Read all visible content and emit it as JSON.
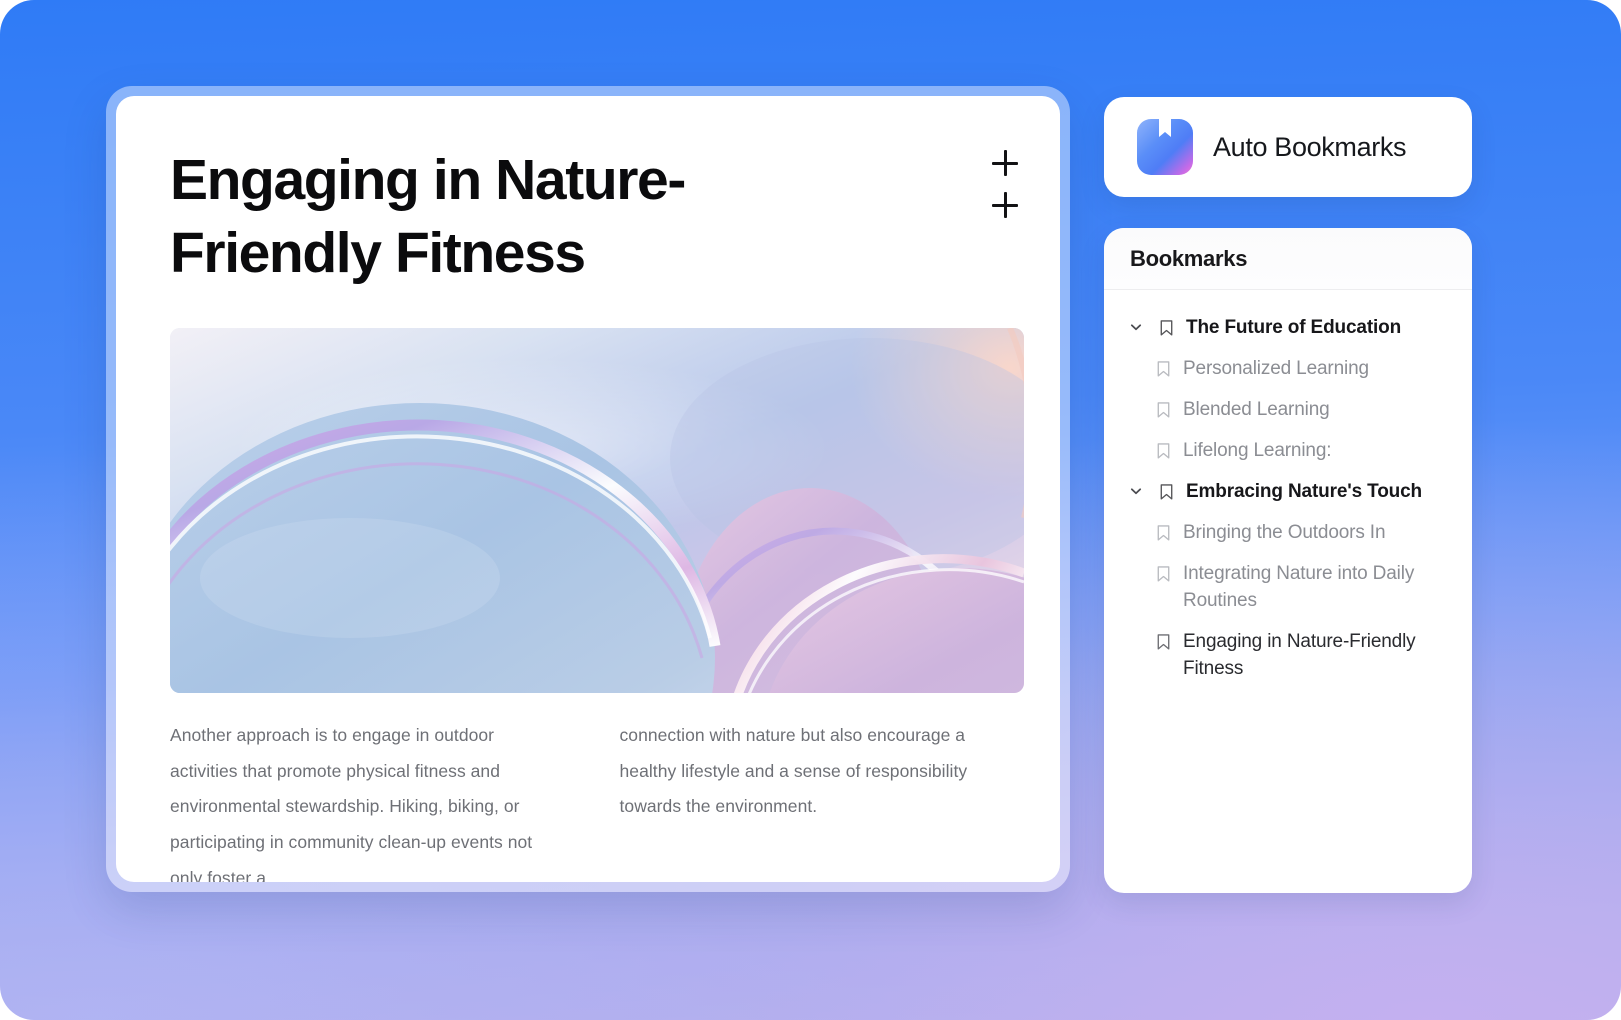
{
  "background": {
    "top_color": "#3b81f6",
    "bottom_color": "#bdb4ea"
  },
  "article": {
    "title": "Engaging in Nature-Friendly Fitness",
    "add_buttons": [
      {
        "name": "add-button-1",
        "label": "+"
      },
      {
        "name": "add-button-2",
        "label": "+"
      }
    ],
    "hero_image_alt": "abstract iridescent bubbles gradient",
    "columns": [
      {
        "text": "Another approach is to engage in outdoor activities that promote physical fitness and environmental stewardship. Hiking, biking, or participating in community clean-up events not only foster a"
      },
      {
        "text": "connection with nature but also encourage a healthy lifestyle and a sense of responsibility towards the environment."
      }
    ]
  },
  "app_header": {
    "icon_name": "bookmark-app-icon",
    "title": "Auto Bookmarks"
  },
  "bookmarks_panel": {
    "header": "Bookmarks",
    "items": [
      {
        "label": "The Future of Education",
        "type": "group",
        "expanded": true,
        "active": false
      },
      {
        "label": "Personalized Learning",
        "type": "child",
        "active": false
      },
      {
        "label": "Blended Learning",
        "type": "child",
        "active": false
      },
      {
        "label": "Lifelong Learning:",
        "type": "child",
        "active": false
      },
      {
        "label": "Embracing Nature's Touch",
        "type": "group",
        "expanded": true,
        "active": false
      },
      {
        "label": "Bringing the Outdoors In",
        "type": "child",
        "active": false
      },
      {
        "label": "Integrating Nature into Daily Routines",
        "type": "child",
        "active": false
      },
      {
        "label": "Engaging in Nature-Friendly Fitness",
        "type": "child",
        "active": true
      }
    ]
  }
}
